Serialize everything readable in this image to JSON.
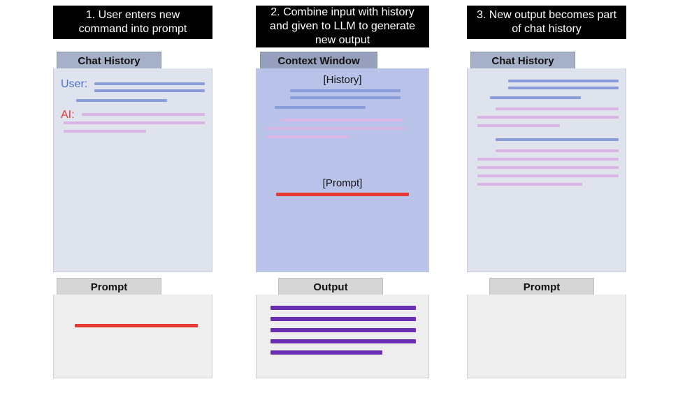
{
  "steps": [
    {
      "title": "1. User enters new command into prompt"
    },
    {
      "title": "2. Combine input with history and given to LLM to generate new output"
    },
    {
      "title": "3. New output becomes part of chat history"
    }
  ],
  "tabs": {
    "chat_history": "Chat History",
    "context_window": "Context Window",
    "prompt": "Prompt",
    "output": "Output"
  },
  "roles": {
    "user": "User:",
    "ai": "AI:"
  },
  "context_labels": {
    "history": "[History]",
    "prompt": "[Prompt]"
  },
  "colors": {
    "user_line": "#8b9dd8",
    "ai_line": "#d9b6e4",
    "prompt_line": "#e53935",
    "output_line": "#6a2fb0",
    "header_bg": "#000000",
    "header_text": "#ffffff",
    "tab_blue": "#a6b0c8",
    "tab_grey": "#d6d6d6",
    "panel_blue": "#dfe3ed",
    "panel_context": "#b9c3ea",
    "panel_grey": "#eeeeee"
  }
}
